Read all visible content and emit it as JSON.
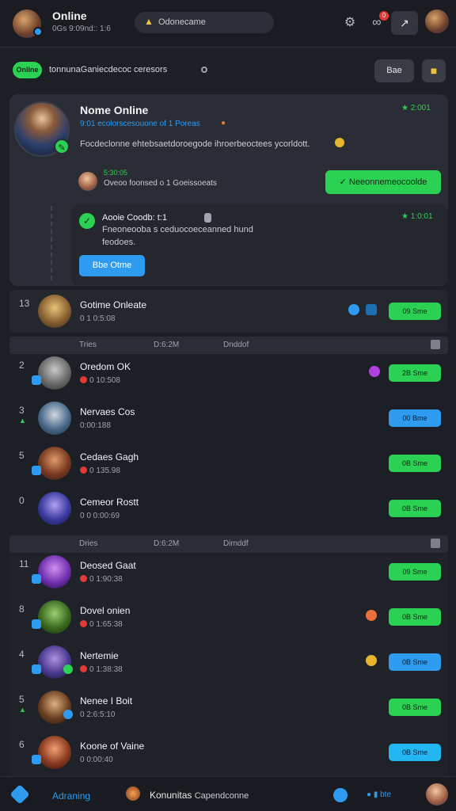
{
  "header": {
    "title": "Online",
    "subtitle": "0Gs 9:09nd:: 1:6",
    "search_label": "Odonecame",
    "notification_count": "0"
  },
  "subbar": {
    "online_label": "Online",
    "text": "tonnunaGaniecdecoc ceresors",
    "button_label": "Bae"
  },
  "profile": {
    "name": "Nome Online",
    "tagline": "9:01  ecolorscesouone of 1 Poreas",
    "description": "Focdeclonne ehtebsaetdoroegode ihroerbeoctees ycorldott.",
    "stat": "2:001",
    "mini_top": "5:30:05",
    "mini_text": "Oveoo  foonsed o  1 Goeissoeats",
    "action_label": "Neeonnemeocoolde",
    "post_title": "Aooie  Coodb:   t:1",
    "post_line1": "Fneoneooba s ceduocoeceanned hund",
    "post_line2": "feodoes.",
    "post_stat": "1:0:01",
    "post_button": "Bbe Otme"
  },
  "table_head_1": {
    "col1": "Tries",
    "col2": "D:6:2M",
    "col3": "Dnddof"
  },
  "table_head_2": {
    "col1": "Dries",
    "col2": "D:6:2M",
    "col3": "Dimddf"
  },
  "rows": [
    {
      "rank": "13",
      "name": "Gotime Onleate",
      "meta": "0 1 0:5:08",
      "action": "09 Sme",
      "color": "green"
    },
    {
      "rank": "2",
      "name": "Oredom OK",
      "meta": "0 10:508",
      "action": "2B Sme",
      "color": "green"
    },
    {
      "rank": "3",
      "name": "Nervaes Cos",
      "meta": "0:00:188",
      "action": "00 Bme",
      "color": "blue"
    },
    {
      "rank": "5",
      "name": "Cedaes Gagh",
      "meta": "0 135.98",
      "action": "0B Sme",
      "color": "green"
    },
    {
      "rank": "0",
      "name": "Cemeor Rostt",
      "meta": "0 0 0:00:69",
      "action": "0B Sme",
      "color": "green"
    },
    {
      "rank": "11",
      "name": "Deosed Gaat",
      "meta": "0 1:90:38",
      "action": "09 Sme",
      "color": "green"
    },
    {
      "rank": "8",
      "name": "Dovel onien",
      "meta": "0 1:65:38",
      "action": "0B Sme",
      "color": "green"
    },
    {
      "rank": "4",
      "name": "Nertemie",
      "meta": "0 1:38:38",
      "action": "0B Sme",
      "color": "blue"
    },
    {
      "rank": "5",
      "name": "Nenee I Boit",
      "meta": "0 2:6:5:10",
      "action": "0B Sme",
      "color": "green"
    },
    {
      "rank": "6",
      "name": "Koone of Vaine",
      "meta": "0 0:00:40",
      "action": "0B Sme",
      "color": "cyan"
    }
  ],
  "bottom": {
    "nav_label": "Adraning",
    "community_title": "Konunitas",
    "community_sub": "Capendconne",
    "right_label": "bte"
  },
  "colors": {
    "accent_green": "#2ad152",
    "accent_blue": "#2e9bf0",
    "bg": "#1c1f26"
  }
}
